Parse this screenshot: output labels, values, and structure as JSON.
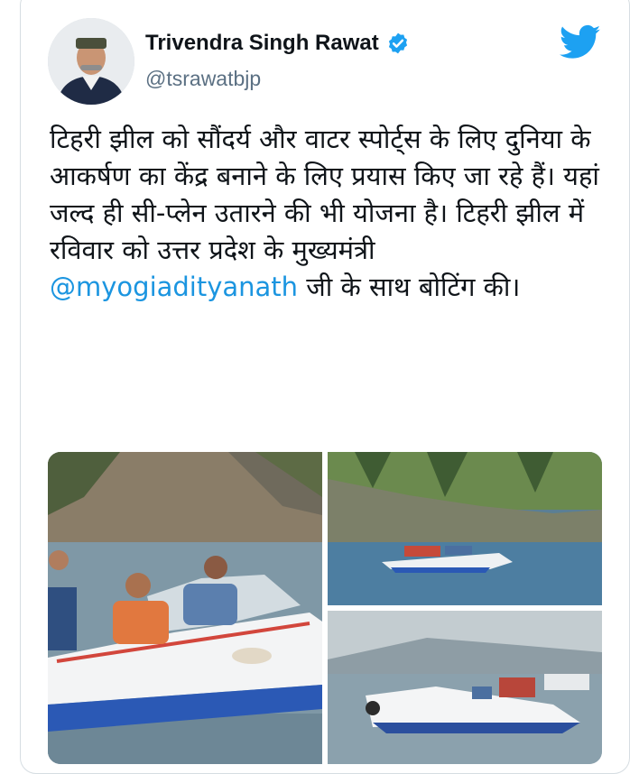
{
  "tweet": {
    "author_name": "Trivendra Singh Rawat",
    "author_handle": "@tsrawatbjp",
    "verified": true,
    "verified_icon": "verified-badge-icon",
    "platform_icon": "twitter-bird-icon",
    "text_part1": "टिहरी झील को सौंदर्य और वाटर स्पोर्ट्स के लिए दुनिया के आकर्षण का केंद्र बनाने के लिए प्रयास किए जा रहे हैं। यहां जल्द ही सी-प्लेन उतारने की भी योजना है। टिहरी झील में रविवार को उत्तर प्रदेश के मुख्यमंत्री ",
    "mention": "@myogiadityanath",
    "text_part2": " जी के साथ बोटिंग की।"
  },
  "colors": {
    "link": "#1b95e0",
    "twitter_blue": "#1da1f2",
    "handle_gray": "#5b7083",
    "border": "#d6dde2"
  },
  "media": {
    "count": 3,
    "items": [
      "boating-photo-closeup",
      "boating-photo-lake-wide",
      "boating-photo-lake-group"
    ]
  }
}
